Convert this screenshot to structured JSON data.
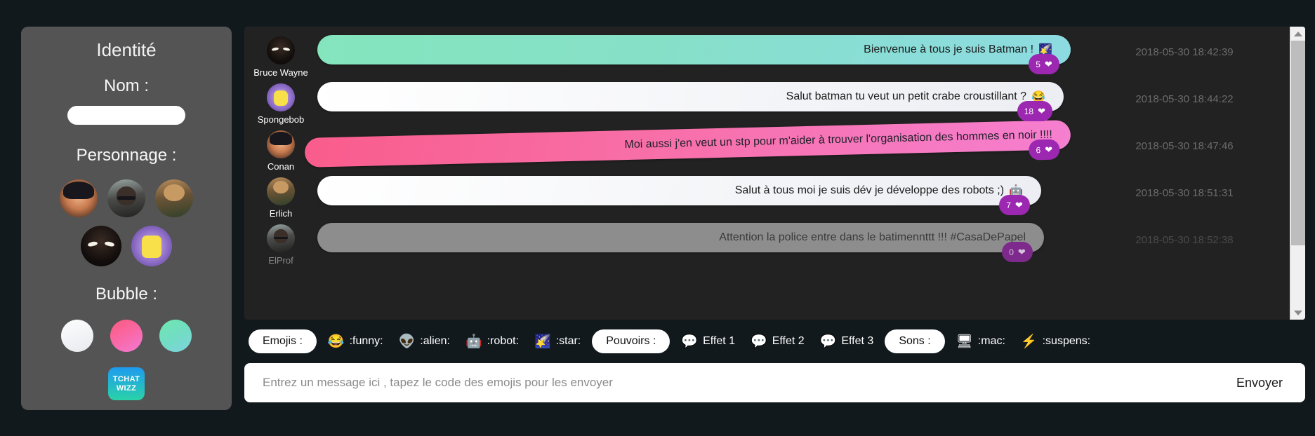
{
  "sidebar": {
    "title": "Identité",
    "name_label": "Nom :",
    "name_value": "",
    "name_placeholder": "",
    "personnage_label": "Personnage :",
    "avatars": [
      {
        "name": "Conan",
        "icon": "conan-avatar"
      },
      {
        "name": "ElProf",
        "icon": "elprof-avatar"
      },
      {
        "name": "Erlich",
        "icon": "erlich-avatar"
      },
      {
        "name": "Bruce Wayne",
        "icon": "batman-avatar"
      },
      {
        "name": "Spongebob",
        "icon": "spongebob-avatar"
      }
    ],
    "bubble_label": "Bubble :",
    "bubbles": [
      {
        "name": "white",
        "color": "#eceef3"
      },
      {
        "name": "pink",
        "color": "#f968a6"
      },
      {
        "name": "teal",
        "color": "#7fd6c9"
      }
    ],
    "logo_line1": "TCHAT",
    "logo_line2": "WIZZ"
  },
  "chat": {
    "messages": [
      {
        "author": "Bruce Wayne",
        "avatar": "batman-avatar",
        "text": "Bienvenue à tous je suis Batman !",
        "emoji": "🌠",
        "style": "teal",
        "likes": "5",
        "time": "2018-05-30 18:42:39",
        "muted": false,
        "tilt": false
      },
      {
        "author": "Spongebob",
        "avatar": "spongebob-avatar",
        "text": "Salut batman tu veut un petit crabe croustillant ?",
        "emoji": "😂",
        "style": "white",
        "likes": "18",
        "time": "2018-05-30 18:44:22",
        "muted": false,
        "tilt": false
      },
      {
        "author": "Conan",
        "avatar": "conan-avatar",
        "text": "Moi aussi j'en veut un stp pour m'aider à trouver l'organisation des hommes en noir !!!!",
        "emoji": "",
        "style": "pink",
        "likes": "6",
        "time": "2018-05-30 18:47:46",
        "muted": false,
        "tilt": true
      },
      {
        "author": "Erlich",
        "avatar": "erlich-avatar",
        "text": "Salut à tous moi je suis dév je développe des robots ;)",
        "emoji": "🤖",
        "style": "white",
        "likes": "7",
        "time": "2018-05-30 18:51:31",
        "muted": false,
        "tilt": false
      },
      {
        "author": "ElProf",
        "avatar": "elprof-avatar",
        "text": "Attention la police entre dans le batimennttt !!! #CasaDePapel",
        "emoji": "",
        "style": "grey",
        "likes": "0",
        "time": "2018-05-30 18:52:38",
        "muted": true,
        "tilt": false
      }
    ]
  },
  "toolbar": {
    "emojis_label": "Emojis :",
    "emojis": [
      {
        "glyph": "😂",
        "code": ":funny:",
        "icon": "joy-emoji"
      },
      {
        "glyph": "👽",
        "code": ":alien:",
        "icon": "alien-emoji"
      },
      {
        "glyph": "🤖",
        "code": ":robot:",
        "icon": "robot-emoji"
      },
      {
        "glyph": "🌠",
        "code": ":star:",
        "icon": "star-emoji"
      }
    ],
    "pouvoirs_label": "Pouvoirs :",
    "pouvoirs": [
      {
        "glyph": "💬",
        "code": "Effet 1",
        "icon": "speech-balloon-icon"
      },
      {
        "glyph": "💬",
        "code": "Effet 2",
        "icon": "speech-balloon-icon"
      },
      {
        "glyph": "💬",
        "code": "Effet 3",
        "icon": "speech-balloon-icon"
      }
    ],
    "sons_label": "Sons :",
    "sons": [
      {
        "glyph": "🖥",
        "code": ":mac:",
        "icon": "computer-icon"
      },
      {
        "glyph": "⚡",
        "code": ":suspens:",
        "icon": "lightning-icon"
      }
    ]
  },
  "composer": {
    "placeholder": "Entrez un message ici , tapez le code des emojis pour les envoyer",
    "value": "",
    "send_label": "Envoyer"
  },
  "colors": {
    "badge": "#9c27b0",
    "sidebar_bg": "#545454",
    "chat_bg": "#222222",
    "page_bg": "#12191d"
  }
}
